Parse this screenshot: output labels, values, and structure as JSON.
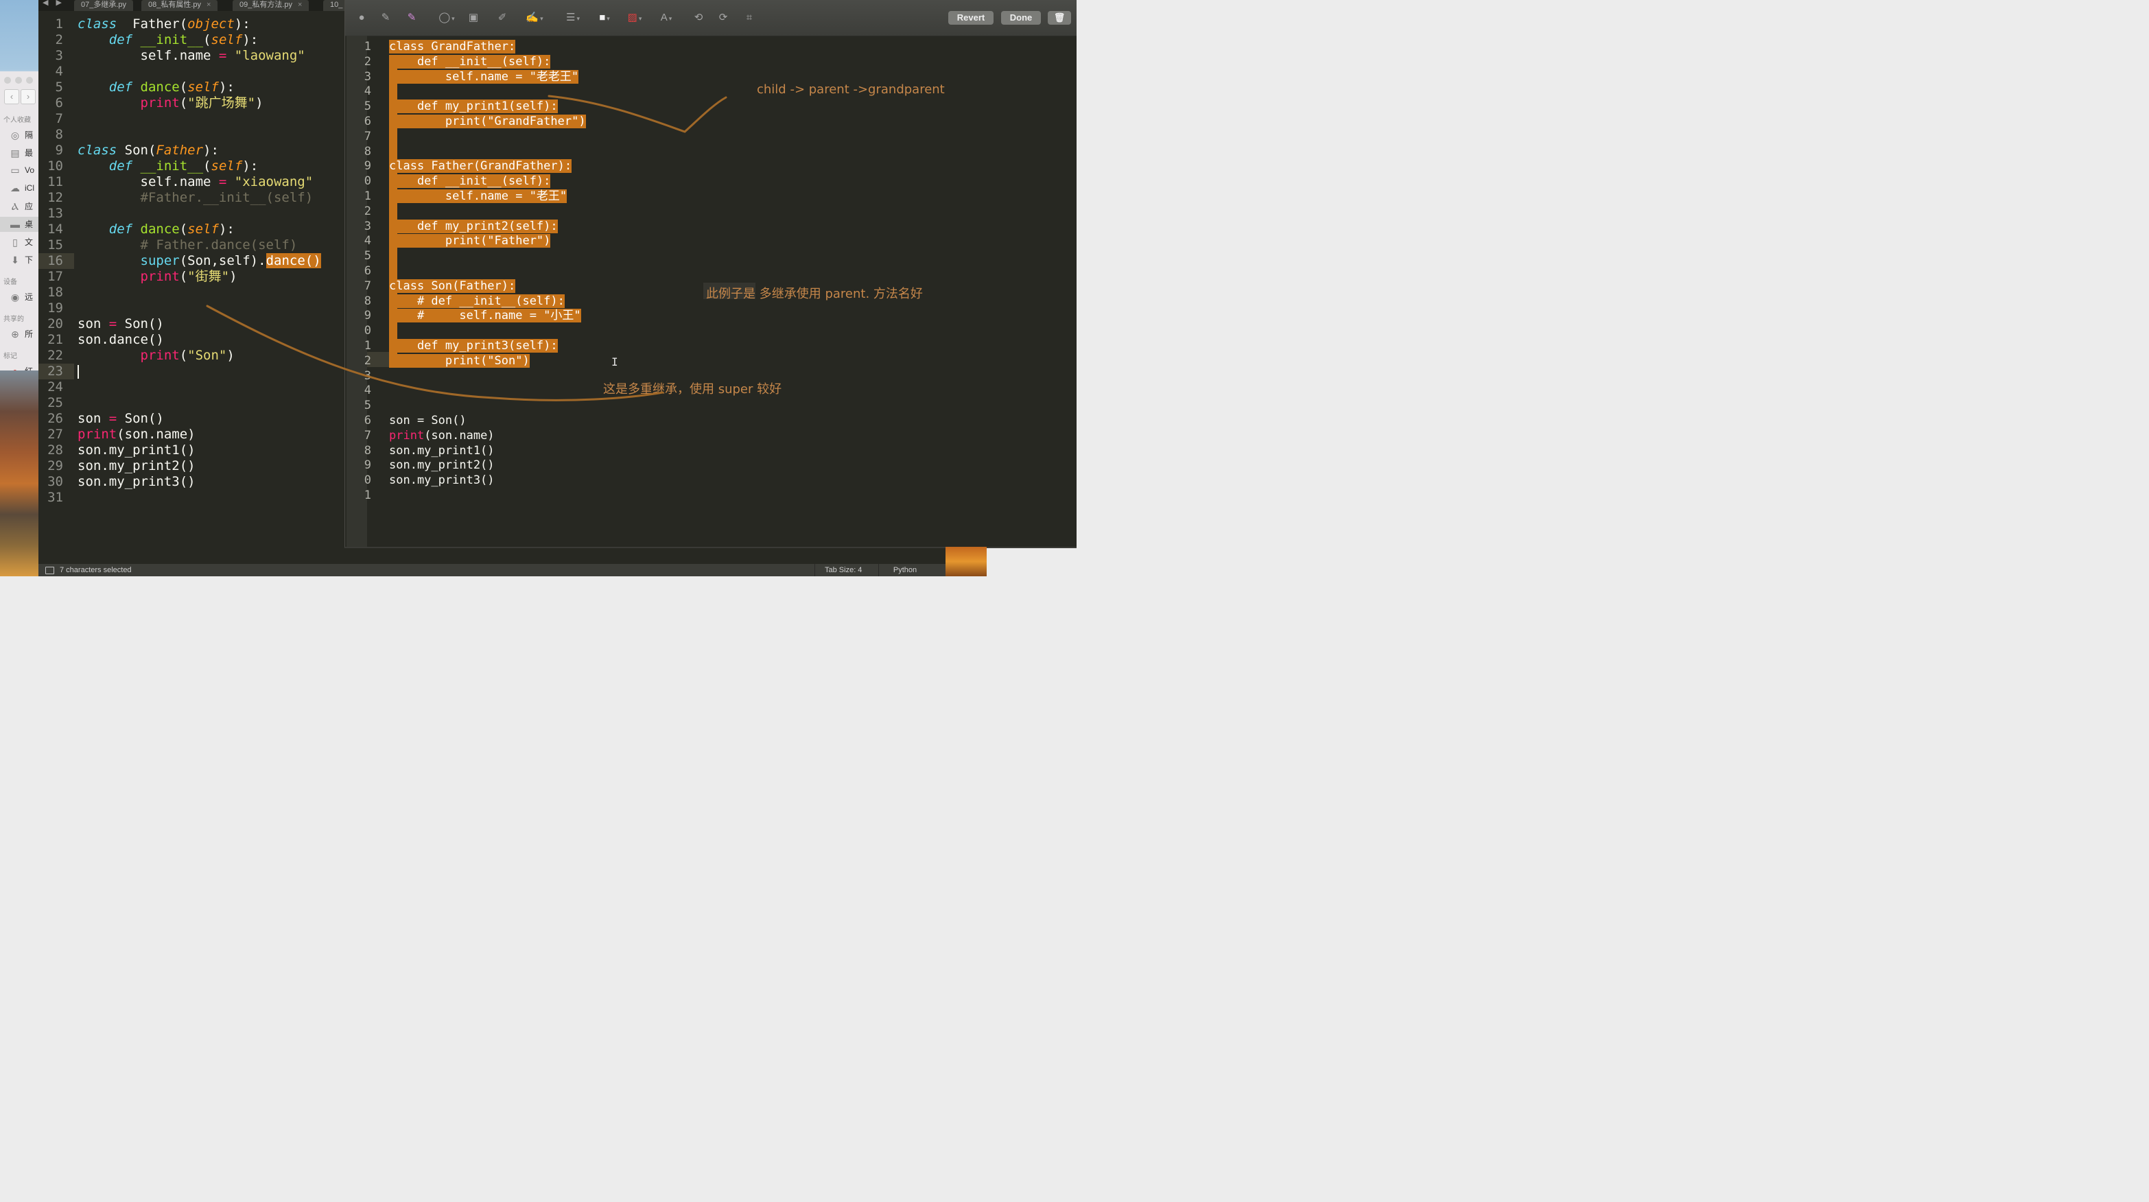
{
  "finder": {
    "section_favorites": "个人收藏",
    "items": [
      {
        "label": "隔"
      },
      {
        "label": "最"
      },
      {
        "label": "Vo"
      },
      {
        "label": "iCl"
      },
      {
        "label": "应"
      },
      {
        "label": "桌"
      },
      {
        "label": "文"
      },
      {
        "label": "下"
      }
    ],
    "section_devices": "设备",
    "device_item": "远",
    "section_shared": "共享的",
    "shared_item": "所",
    "section_tags": "标记",
    "tag_item": "红"
  },
  "tabs": [
    {
      "label": "07_多继承.py"
    },
    {
      "label": "08_私有属性.py"
    },
    {
      "label": "09_私有方法.py"
    },
    {
      "label": "10_"
    }
  ],
  "status": {
    "selection_text": "7 characters selected",
    "tab_size": "Tab Size: 4",
    "syntax": "Python"
  },
  "markup_toolbar": {
    "revert_label": "Revert",
    "done_label": "Done"
  },
  "annotations": {
    "note1": "child -> parent ->grandparent",
    "note2": "此例子是  多继承使用 parent. 方法名好",
    "note3": "这是多重继承，使用 super 较好"
  },
  "colors": {
    "accent_selection": "#c8741a",
    "annotation": "#c6874a",
    "editor_bg": "#272822"
  }
}
